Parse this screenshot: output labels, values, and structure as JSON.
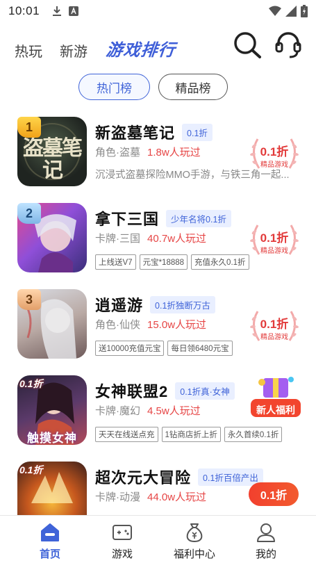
{
  "status_bar": {
    "time": "10:01"
  },
  "header": {
    "tabs": [
      {
        "label": "热玩"
      },
      {
        "label": "新游"
      },
      {
        "label": "游戏排行"
      }
    ]
  },
  "segments": [
    {
      "label": "热门榜",
      "active": true
    },
    {
      "label": "精品榜",
      "active": false
    }
  ],
  "games": [
    {
      "rank": "1",
      "name": "新盗墓笔记",
      "tag": "0.1折",
      "category": "角色·盗墓",
      "players": "1.8w人玩过",
      "description": "沉浸式盗墓探险MMO手游，与铁三角一起...",
      "award_value": "0.1折",
      "award_label": "精品游戏",
      "icon_text": "盗墓笔记"
    },
    {
      "rank": "2",
      "name": "拿下三国",
      "tag": "少年名将0.1折",
      "category": "卡牌·三国",
      "players": "40.7w人玩过",
      "chips": [
        "上线送V7",
        "元宝*18888",
        "充值永久0.1折"
      ],
      "award_value": "0.1折",
      "award_label": "精品游戏"
    },
    {
      "rank": "3",
      "name": "逍遥游",
      "tag": "0.1折独断万古",
      "category": "角色·仙侠",
      "players": "15.0w人玩过",
      "chips": [
        "送10000充值元宝",
        "每日领6480元宝"
      ],
      "award_value": "0.1折",
      "award_label": "精品游戏"
    },
    {
      "rank": "",
      "name": "女神联盟2",
      "tag": "0.1折真·女神",
      "category": "卡牌·魔幻",
      "players": "4.5w人玩过",
      "chips": [
        "天天在线送点充",
        "1钻商店折上折",
        "永久首续0.1折"
      ],
      "promo_label": "新人福利",
      "icon_text": "触摸女神",
      "icon_corner": "0.1折"
    },
    {
      "rank": "",
      "name": "超次元大冒险",
      "tag": "0.1折百倍产出",
      "category": "卡牌·动漫",
      "players": "44.0w人玩过",
      "button_label": "0.1折",
      "icon_corner": "0.1折"
    }
  ],
  "bottom_nav": [
    {
      "label": "首页",
      "icon": "home-icon",
      "active": true
    },
    {
      "label": "游戏",
      "icon": "gamepad-icon",
      "active": false
    },
    {
      "label": "福利中心",
      "icon": "money-bag-icon",
      "active": false
    },
    {
      "label": "我的",
      "icon": "person-icon",
      "active": false
    }
  ],
  "colors": {
    "accent": "#3f63d8",
    "price_red": "#e23a3a",
    "text_gray": "#8a8a8a"
  }
}
